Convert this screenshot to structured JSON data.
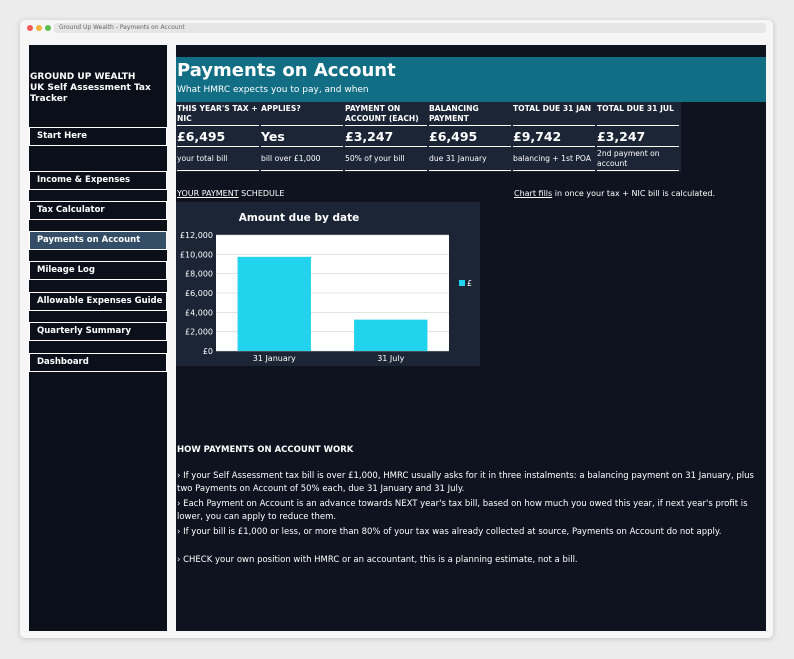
{
  "window": {
    "title": "Ground Up Wealth - Payments on Account"
  },
  "sidebar": {
    "brand_line1": "GROUND UP WEALTH",
    "brand_line2": "UK Self Assessment Tax Tracker",
    "items": [
      {
        "label": "Start Here",
        "active": false
      },
      {
        "label": "Income & Expenses",
        "active": false
      },
      {
        "label": "Tax Calculator",
        "active": false
      },
      {
        "label": "Payments on Account",
        "active": true
      },
      {
        "label": "Mileage Log",
        "active": false
      },
      {
        "label": "Allowable Expenses Guide",
        "active": false
      },
      {
        "label": "Quarterly Summary",
        "active": false
      },
      {
        "label": "Dashboard",
        "active": false
      }
    ]
  },
  "header": {
    "title": "Payments on Account",
    "subtitle": "What HMRC expects you to pay, and when"
  },
  "summary": [
    {
      "heading": "THIS YEAR'S TAX + NIC",
      "value": "£6,495",
      "sub": "your total bill"
    },
    {
      "heading": "APPLIES?",
      "value": "Yes",
      "sub": "bill over £1,000"
    },
    {
      "heading": "PAYMENT ON ACCOUNT (EACH)",
      "value": "£3,247",
      "sub": "50% of your bill"
    },
    {
      "heading": "BALANCING PAYMENT",
      "value": "£6,495",
      "sub": "due 31 January"
    },
    {
      "heading": "TOTAL DUE 31 JAN",
      "value": "£9,742",
      "sub": "balancing + 1st POA"
    },
    {
      "heading": "TOTAL DUE 31 JUL",
      "value": "£3,247",
      "sub": "2nd payment on account"
    }
  ],
  "schedule": {
    "label_underlined": "YOUR PAYMENT",
    "label_rest": " SCHEDULE",
    "note_underlined": "Chart fills",
    "note_rest": " in once your tax + NIC bill is calculated."
  },
  "chart_data": {
    "type": "bar",
    "title": "Amount due by date",
    "categories": [
      "31 January",
      "31 July"
    ],
    "series": [
      {
        "name": "£",
        "values": [
          9742,
          3247
        ],
        "color": "#22d3ee"
      }
    ],
    "ylim": [
      0,
      12000
    ],
    "yticks": [
      0,
      2000,
      4000,
      6000,
      8000,
      10000,
      12000
    ],
    "ytick_labels": [
      "£0",
      "£2,000",
      "£4,000",
      "£6,000",
      "£8,000",
      "£10,000",
      "£12,000"
    ],
    "grid": true,
    "legend": "right"
  },
  "explainer": {
    "heading": "HOW PAYMENTS ON ACCOUNT WORK",
    "bullets": [
      "›  If your Self Assessment tax bill is over £1,000, HMRC usually asks for it in three instalments: a balancing payment on 31 January, plus two Payments on Account of 50% each, due 31 January and 31 July.",
      "›  Each Payment on Account is an advance towards NEXT year's tax bill, based on how much you owed this year, if next year's profit is lower, you can apply to reduce them.",
      "›  If your bill is £1,000 or less, or more than 80% of your tax was already collected at source, Payments on Account do not apply.",
      "›  CHECK your own position with HMRC or an accountant, this is a planning estimate, not a bill."
    ]
  }
}
